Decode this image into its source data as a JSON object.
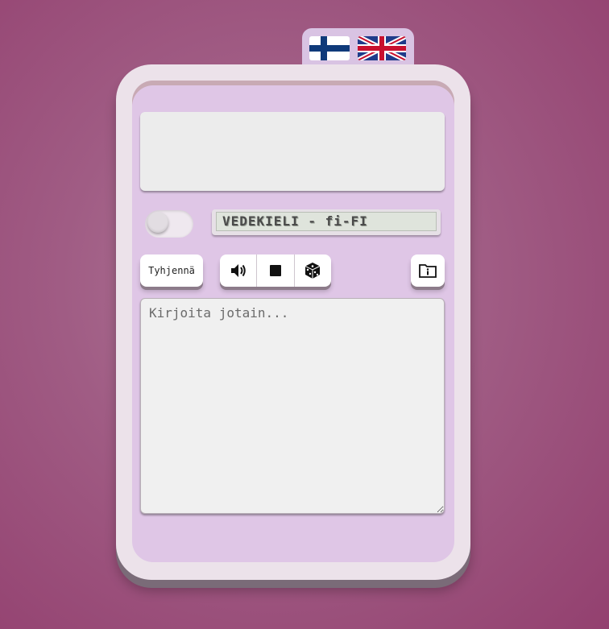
{
  "language_flags": {
    "finnish": "Finnish flag",
    "english": "UK flag"
  },
  "voice_display": {
    "language_label": "VEDEKIELI - fi-FI"
  },
  "controls": {
    "clear_label": "Tyhjennä",
    "speak_icon": "speaker-icon",
    "stop_icon": "stop-icon",
    "random_icon": "dice-icon",
    "info_icon": "info-icon"
  },
  "input": {
    "placeholder": "Kirjoita jotain...",
    "value": ""
  },
  "colors": {
    "background": "#a05c84",
    "device": "#ece2ea",
    "screen": "#dfc6e6",
    "flag_blue": "#0f3a7a"
  }
}
